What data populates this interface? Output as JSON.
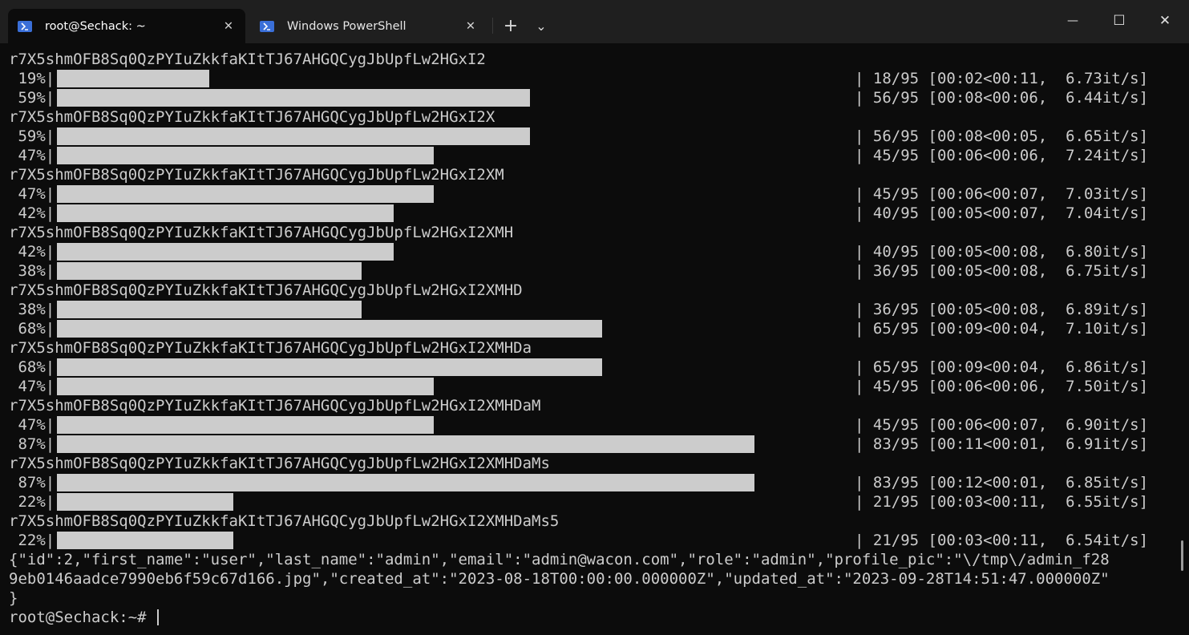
{
  "tabs": [
    {
      "label": "root@Sechack: ~",
      "active": true
    },
    {
      "label": "Windows PowerShell",
      "active": false
    }
  ],
  "controls": {
    "new_tab": "+",
    "dropdown": "⌄",
    "minimize": "—",
    "maximize": "☐",
    "close": "✕",
    "tab_close": "✕"
  },
  "terminal": {
    "blocks": [
      {
        "key": "r7X5shmOFB8Sq0QzPYIuZkkfaKItTJ67AHGQCygJbUpfLw2HGxI2",
        "bars": [
          {
            "pct": " 19%|",
            "progress": 0.19,
            "stats": "| 18/95 [00:02<00:11,  6.73it/s]"
          },
          {
            "pct": " 59%|",
            "progress": 0.59,
            "stats": "| 56/95 [00:08<00:06,  6.44it/s]"
          }
        ]
      },
      {
        "key": "r7X5shmOFB8Sq0QzPYIuZkkfaKItTJ67AHGQCygJbUpfLw2HGxI2X",
        "bars": [
          {
            "pct": " 59%|",
            "progress": 0.59,
            "stats": "| 56/95 [00:08<00:05,  6.65it/s]"
          },
          {
            "pct": " 47%|",
            "progress": 0.47,
            "stats": "| 45/95 [00:06<00:06,  7.24it/s]"
          }
        ]
      },
      {
        "key": "r7X5shmOFB8Sq0QzPYIuZkkfaKItTJ67AHGQCygJbUpfLw2HGxI2XM",
        "bars": [
          {
            "pct": " 47%|",
            "progress": 0.47,
            "stats": "| 45/95 [00:06<00:07,  7.03it/s]"
          },
          {
            "pct": " 42%|",
            "progress": 0.42,
            "stats": "| 40/95 [00:05<00:07,  7.04it/s]"
          }
        ]
      },
      {
        "key": "r7X5shmOFB8Sq0QzPYIuZkkfaKItTJ67AHGQCygJbUpfLw2HGxI2XMH",
        "bars": [
          {
            "pct": " 42%|",
            "progress": 0.42,
            "stats": "| 40/95 [00:05<00:08,  6.80it/s]"
          },
          {
            "pct": " 38%|",
            "progress": 0.38,
            "stats": "| 36/95 [00:05<00:08,  6.75it/s]"
          }
        ]
      },
      {
        "key": "r7X5shmOFB8Sq0QzPYIuZkkfaKItTJ67AHGQCygJbUpfLw2HGxI2XMHD",
        "bars": [
          {
            "pct": " 38%|",
            "progress": 0.38,
            "stats": "| 36/95 [00:05<00:08,  6.89it/s]"
          },
          {
            "pct": " 68%|",
            "progress": 0.68,
            "stats": "| 65/95 [00:09<00:04,  7.10it/s]"
          }
        ]
      },
      {
        "key": "r7X5shmOFB8Sq0QzPYIuZkkfaKItTJ67AHGQCygJbUpfLw2HGxI2XMHDa",
        "bars": [
          {
            "pct": " 68%|",
            "progress": 0.68,
            "stats": "| 65/95 [00:09<00:04,  6.86it/s]"
          },
          {
            "pct": " 47%|",
            "progress": 0.47,
            "stats": "| 45/95 [00:06<00:06,  7.50it/s]"
          }
        ]
      },
      {
        "key": "r7X5shmOFB8Sq0QzPYIuZkkfaKItTJ67AHGQCygJbUpfLw2HGxI2XMHDaM",
        "bars": [
          {
            "pct": " 47%|",
            "progress": 0.47,
            "stats": "| 45/95 [00:06<00:07,  6.90it/s]"
          },
          {
            "pct": " 87%|",
            "progress": 0.87,
            "stats": "| 83/95 [00:11<00:01,  6.91it/s]"
          }
        ]
      },
      {
        "key": "r7X5shmOFB8Sq0QzPYIuZkkfaKItTJ67AHGQCygJbUpfLw2HGxI2XMHDaMs",
        "bars": [
          {
            "pct": " 87%|",
            "progress": 0.87,
            "stats": "| 83/95 [00:12<00:01,  6.85it/s]"
          },
          {
            "pct": " 22%|",
            "progress": 0.22,
            "stats": "| 21/95 [00:03<00:11,  6.55it/s]"
          }
        ]
      },
      {
        "key": "r7X5shmOFB8Sq0QzPYIuZkkfaKItTJ67AHGQCygJbUpfLw2HGxI2XMHDaMs5",
        "bars": [
          {
            "pct": " 22%|",
            "progress": 0.22,
            "stats": "| 21/95 [00:03<00:11,  6.54it/s]"
          }
        ]
      }
    ],
    "json_lines": [
      "{\"id\":2,\"first_name\":\"user\",\"last_name\":\"admin\",\"email\":\"admin@wacon.com\",\"role\":\"admin\",\"profile_pic\":\"\\/tmp\\/admin_f28",
      "9eb0146aadce7990eb6f59c67d166.jpg\",\"created_at\":\"2023-08-18T00:00:00.000000Z\",\"updated_at\":\"2023-09-28T14:51:47.000000Z\"",
      "}"
    ],
    "prompt": "root@Sechack:~# "
  },
  "colors": {
    "background": "#0c0c0c",
    "text": "#cccccc",
    "titlebar": "#1f1f1f",
    "ps_icon": "#3a6fd8"
  }
}
